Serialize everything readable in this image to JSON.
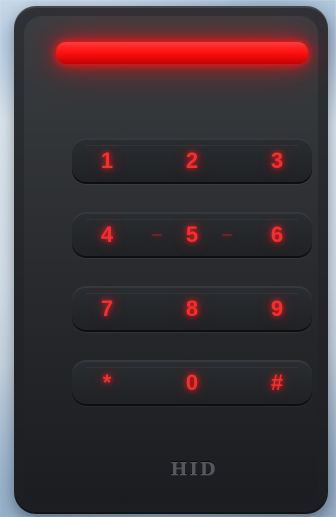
{
  "device": {
    "brand": "HID",
    "led_color": "#ff1a1a",
    "keypad": {
      "rows": [
        [
          "1",
          "2",
          "3"
        ],
        [
          "4",
          "5",
          "6"
        ],
        [
          "7",
          "8",
          "9"
        ],
        [
          "*",
          "0",
          "#"
        ]
      ]
    }
  }
}
